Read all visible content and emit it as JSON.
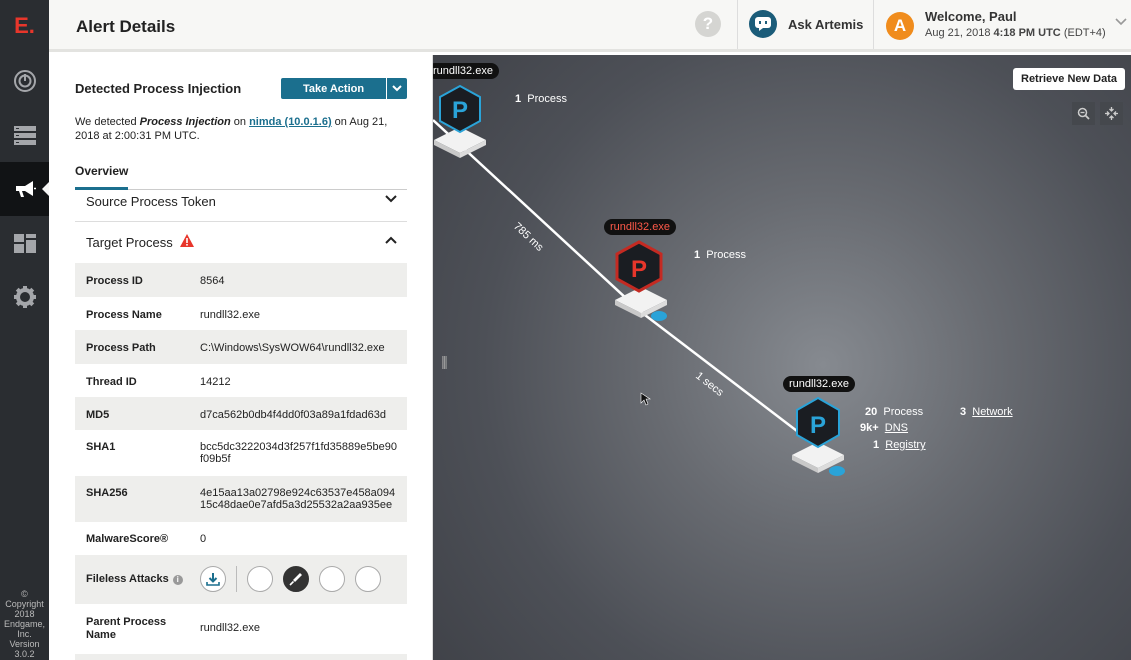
{
  "app": {
    "logo": "E.",
    "copyright": [
      "©",
      "Copyright",
      "2018",
      "Endgame,",
      "Inc.",
      "Version",
      "3.0.2"
    ]
  },
  "nav": {
    "items": [
      "dashboard-icon",
      "database-icon",
      "megaphone-icon",
      "blocks-icon",
      "gear-icon"
    ],
    "active": "megaphone-icon"
  },
  "header": {
    "title": "Alert Details",
    "help": "?",
    "ask_artemis": "Ask Artemis",
    "avatar_letter": "A",
    "welcome": "Welcome, Paul",
    "date_prefix": "Aug 21, 2018 ",
    "date_time": "4:18 PM UTC",
    "date_suffix": " (EDT+4)"
  },
  "panel": {
    "section_title": "Detected Process Injection",
    "take_action": "Take Action",
    "desc": {
      "p1": "We detected ",
      "alert": "Process Injection",
      "p2": " on ",
      "host": "nimda (10.0.1.6)",
      "p3": " on Aug 21, 2018 at 2:00:31 PM UTC."
    },
    "tab": "Overview",
    "source_token": "Source Process Token",
    "target_process": "Target Process",
    "rows": [
      {
        "key": "Process ID",
        "value": "8564"
      },
      {
        "key": "Process Name",
        "value": "rundll32.exe"
      },
      {
        "key": "Process Path",
        "value": "C:\\Windows\\SysWOW64\\rundll32.exe"
      },
      {
        "key": "Thread ID",
        "value": "14212"
      },
      {
        "key": "MD5",
        "value": "d7ca562b0db4f4dd0f03a89a1fdad63d"
      },
      {
        "key": "SHA1",
        "value": "bcc5dc3222034d3f257f1fd35889e5be90f09b5f"
      },
      {
        "key": "SHA256",
        "value": "4e15aa13a02798e924c63537e458a09415c48dae0e7afd5a3d25532a2aa935ee"
      },
      {
        "key": "MalwareScore®",
        "value": "0"
      },
      {
        "key": "Fileless Attacks",
        "value": ""
      },
      {
        "key": "Parent Process Name",
        "value": "rundll32.exe"
      }
    ]
  },
  "graph": {
    "retrieve": "Retrieve New Data",
    "edges": [
      {
        "label": "785 ms"
      },
      {
        "label": "1 secs"
      }
    ],
    "nodes": [
      {
        "tag": "rundll32.exe",
        "letter": "P",
        "count": "1",
        "count_label": "Process"
      },
      {
        "tag": "rundll32.exe",
        "letter": "P",
        "count": "1",
        "count_label": "Process",
        "alert": true
      },
      {
        "tag": "rundll32.exe",
        "letter": "P",
        "stats": [
          {
            "n": "20",
            "label": "Process"
          },
          {
            "n": "9k+",
            "label": "DNS"
          },
          {
            "n": "1",
            "label": "Registry"
          },
          {
            "n": "3",
            "label": "Network"
          }
        ]
      }
    ],
    "colors": {
      "accent": "#1b6f8e",
      "alert": "#e8362b",
      "node_blue": "#2aa3d8"
    }
  }
}
